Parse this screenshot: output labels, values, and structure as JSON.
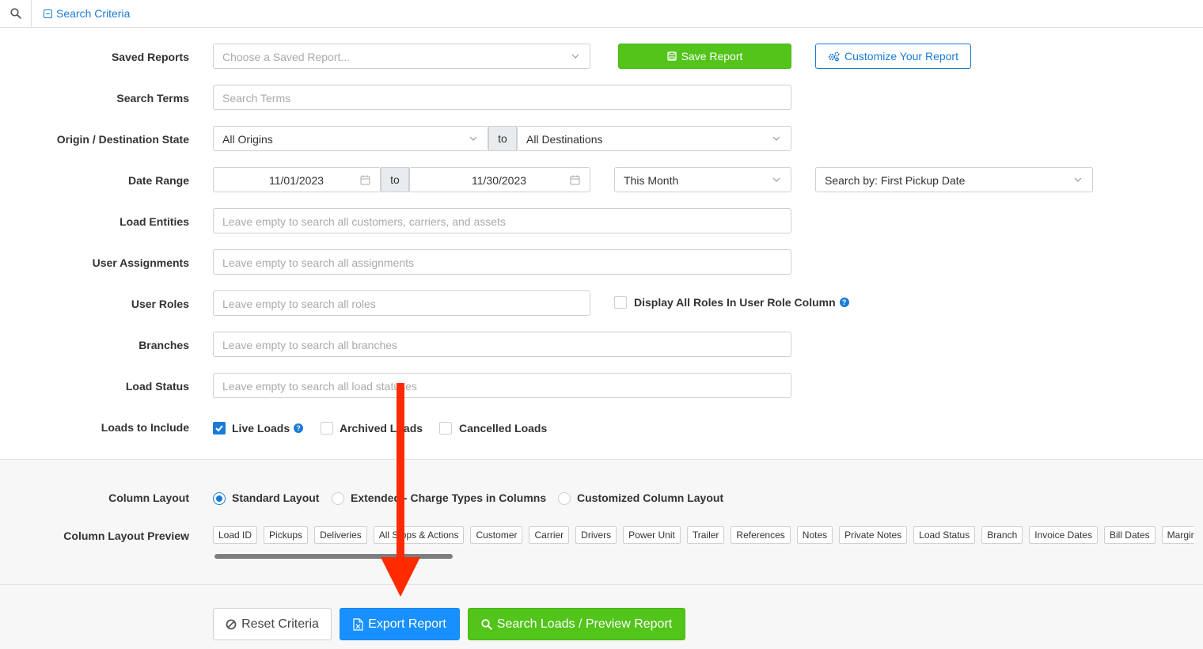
{
  "header": {
    "search_criteria": "Search Criteria"
  },
  "saved_reports": {
    "label": "Saved Reports",
    "placeholder": "Choose a Saved Report...",
    "save_button": "Save Report",
    "customize_button": "Customize Your Report"
  },
  "search_terms": {
    "label": "Search Terms",
    "placeholder": "Search Terms"
  },
  "origin_dest": {
    "label": "Origin / Destination State",
    "origin": "All Origins",
    "to": "to",
    "destination": "All Destinations"
  },
  "date_range": {
    "label": "Date Range",
    "start": "11/01/2023",
    "to": "to",
    "end": "11/30/2023",
    "preset": "This Month",
    "search_by": "Search by: First Pickup Date"
  },
  "load_entities": {
    "label": "Load Entities",
    "placeholder": "Leave empty to search all customers, carriers, and assets"
  },
  "user_assignments": {
    "label": "User Assignments",
    "placeholder": "Leave empty to search all assignments"
  },
  "user_roles": {
    "label": "User Roles",
    "placeholder": "Leave empty to search all roles",
    "display_all": "Display All Roles In User Role Column",
    "display_all_checked": false
  },
  "branches": {
    "label": "Branches",
    "placeholder": "Leave empty to search all branches"
  },
  "load_status": {
    "label": "Load Status",
    "placeholder": "Leave empty to search all load statuses"
  },
  "loads_to_include": {
    "label": "Loads to Include",
    "options": [
      {
        "label": "Live Loads",
        "checked": true
      },
      {
        "label": "Archived Loads",
        "checked": false
      },
      {
        "label": "Cancelled Loads",
        "checked": false
      }
    ]
  },
  "column_layout": {
    "label": "Column Layout",
    "options": [
      {
        "label": "Standard Layout",
        "selected": true
      },
      {
        "label": "Extended - Charge Types in Columns",
        "selected": false
      },
      {
        "label": "Customized Column Layout",
        "selected": false
      }
    ]
  },
  "column_preview": {
    "label": "Column Layout Preview",
    "chips": [
      "Load ID",
      "Pickups",
      "Deliveries",
      "All Stops & Actions",
      "Customer",
      "Carrier",
      "Drivers",
      "Power Unit",
      "Trailer",
      "References",
      "Notes",
      "Private Notes",
      "Load Status",
      "Branch",
      "Invoice Dates",
      "Bill Dates",
      "Margins"
    ]
  },
  "actions": {
    "reset": "Reset Criteria",
    "export": "Export Report",
    "search": "Search Loads / Preview Report"
  },
  "colors": {
    "accent_blue": "#1a7bd6",
    "green": "#52c41a",
    "export_blue": "#1890ff",
    "annotation_red": "#ff2a00"
  }
}
